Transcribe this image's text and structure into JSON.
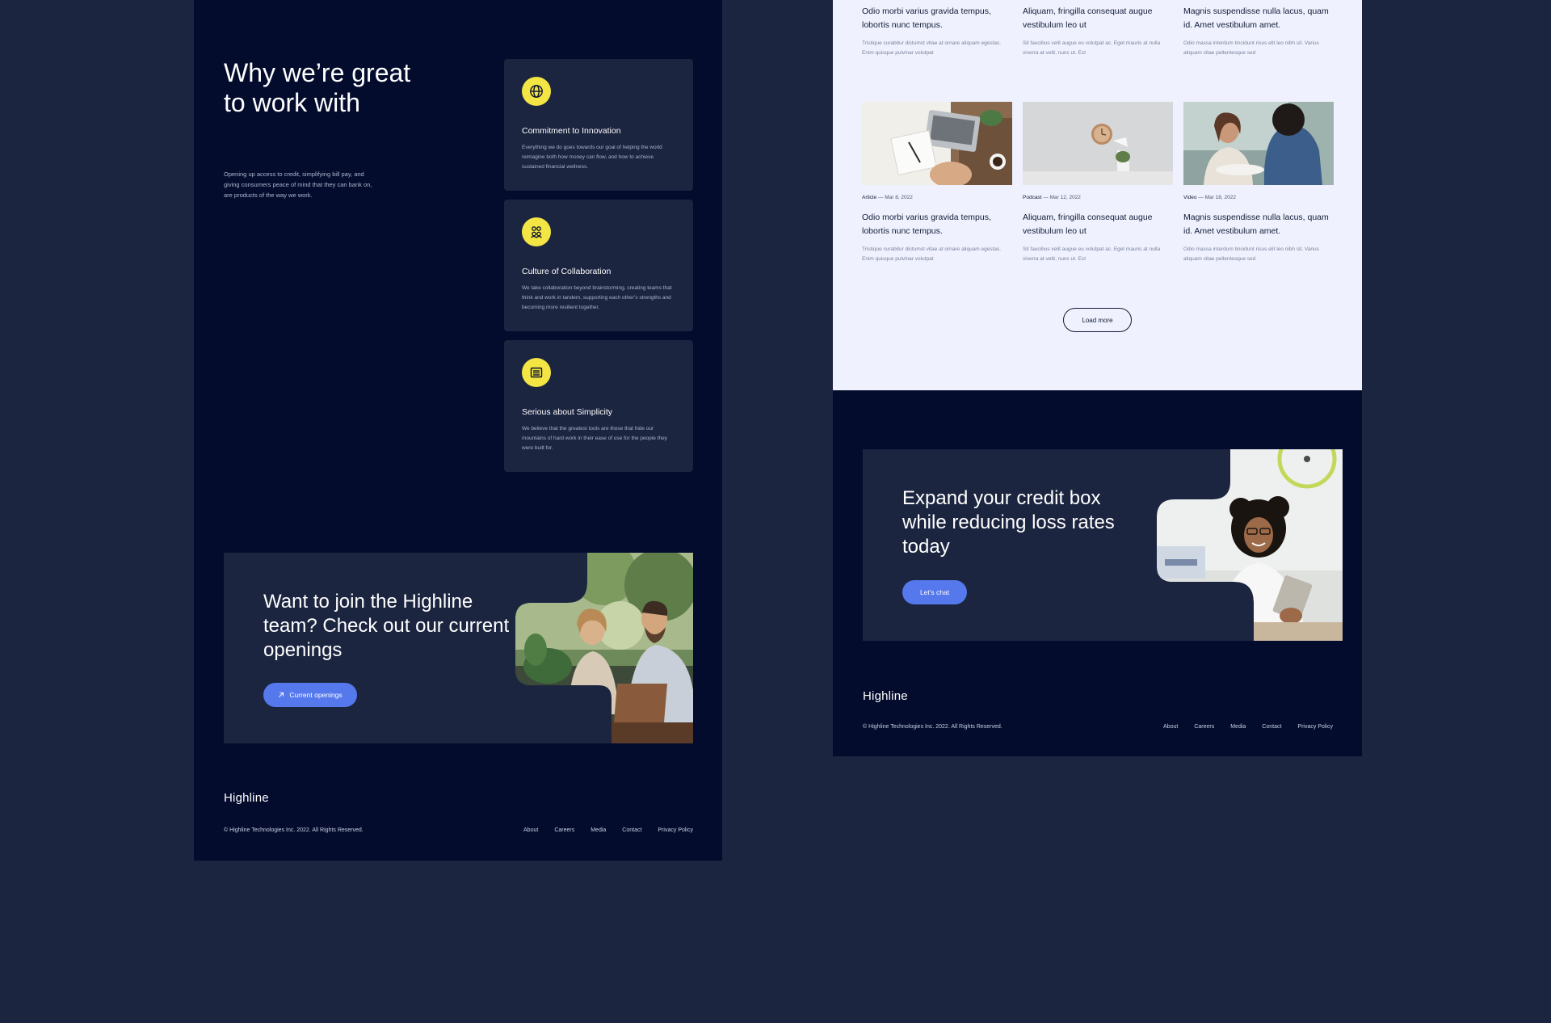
{
  "left": {
    "why": {
      "title": "Why we’re great to work with",
      "description": "Opening up access to credit, simplifying bill pay, and giving consumers peace of mind that they can bank on, are products of the way we work."
    },
    "values": [
      {
        "icon": "globe-icon",
        "title": "Commitment to Innovation",
        "text": "Everything we do goes towards our goal of helping the world reimagine both how money can flow, and how to achieve sustained financial wellness."
      },
      {
        "icon": "team-icon",
        "title": "Culture of Collaboration",
        "text": "We take collaboration beyond brainstorming, creating teams that think and work in tandem, supporting each other’s strengths and becoming more resilient together."
      },
      {
        "icon": "document-icon",
        "title": "Serious about Simplicity",
        "text": "We believe that the greatest tools are those that hide our mountains of hard work in their ease of use for the people they were built for."
      }
    ],
    "cta": {
      "heading": "Want to join the Highline team? Check out our current openings",
      "button_label": "Current openings",
      "button_icon": "arrow-up-right-icon"
    },
    "footer": {
      "logo": "Highline",
      "copyright": "© Highline Technologies Inc. 2022. All Rights Reserved.",
      "links": [
        "About",
        "Careers",
        "Media",
        "Contact",
        "Privacy Policy"
      ]
    }
  },
  "right": {
    "articles_top": [
      {
        "title": "Odio morbi varius gravida tempus, lobortis nunc tempus.",
        "excerpt": "Tristique curabitur dictumst vitae at ornare aliquam egestas. Enim quisque pulvinar volutpat"
      },
      {
        "title": "Aliquam, fringilla consequat augue vestibulum leo ut",
        "excerpt": "Sit faucibus velit augue eu volutpat ac. Eget mauris at nulla viverra at velit, nunc ut. Est"
      },
      {
        "title": "Magnis suspendisse nulla lacus, quam id. Amet vestibulum amet.",
        "excerpt": "Odio massa interdum tincidunt risus elit leo nibh sit. Varius aliquam vitae pellentesque sed"
      }
    ],
    "articles_bottom": [
      {
        "type": "Article",
        "date": "Mar 8, 2022",
        "title": "Odio morbi varius gravida tempus, lobortis nunc tempus.",
        "excerpt": "Tristique curabitur dictumst vitae at ornare aliquam egestas. Enim quisque pulvinar volutpat"
      },
      {
        "type": "Podcast",
        "date": "Mar 12, 2022",
        "title": "Aliquam, fringilla consequat augue vestibulum leo ut",
        "excerpt": "Sit faucibus velit augue eu volutpat ac. Eget mauris at nulla viverra at velit, nunc ut. Est"
      },
      {
        "type": "Video",
        "date": "Mar 18, 2022",
        "title": "Magnis suspendisse nulla lacus, quam id. Amet vestibulum amet.",
        "excerpt": "Odio massa interdum tincidunt risus elit leo nibh sit. Varius aliquam vitae pellentesque sed"
      }
    ],
    "separator": "—",
    "load_more": "Load more",
    "cta": {
      "heading": "Expand your credit box while reducing loss rates today",
      "button_label": "Let's chat"
    },
    "footer": {
      "logo": "Highline",
      "copyright": "© Highline Technologies Inc. 2022. All Rights Reserved.",
      "links": [
        "About",
        "Careers",
        "Media",
        "Contact",
        "Privacy Policy"
      ]
    }
  },
  "colors": {
    "page_bg": "#1c2540",
    "navy": "#040c2e",
    "card": "#1c2540",
    "accent_yellow": "#f3e543",
    "button_blue": "#5578ec",
    "light_bg": "#eff2fe"
  }
}
